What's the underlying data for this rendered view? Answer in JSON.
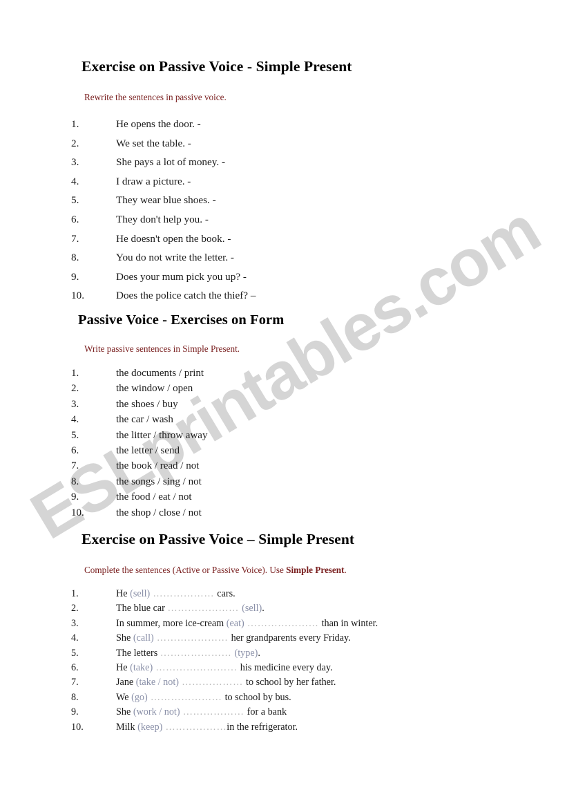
{
  "watermark": {
    "text": "ESLprintables.com",
    "color": "#d5d5d5"
  },
  "colors": {
    "instruction": "#7a2020",
    "verb_hint": "#8a90a8",
    "leader": "#b9b9b9",
    "body_text": "#1a1a1a"
  },
  "sections": [
    {
      "heading": "Exercise on Passive Voice - Simple Present",
      "instruction": "Rewrite the sentences in passive voice.",
      "items": [
        {
          "num": "1.",
          "text": "He opens the door. -"
        },
        {
          "num": "2.",
          "text": "We set the table. -"
        },
        {
          "num": "3.",
          "text": "She pays a lot of money. -"
        },
        {
          "num": "4.",
          "text": "I draw a picture. -"
        },
        {
          "num": "5.",
          "text": "They wear blue shoes. -"
        },
        {
          "num": "6.",
          "text": "They don't help you. -"
        },
        {
          "num": "7.",
          "text": "He doesn't open the book. -"
        },
        {
          "num": "8.",
          "text": "You do not write the letter. -"
        },
        {
          "num": "9.",
          "text": "Does your mum pick you up? -"
        },
        {
          "num": "10.",
          "text": "Does the police catch the thief? –"
        }
      ]
    },
    {
      "heading": "Passive Voice - Exercises on Form",
      "instruction": "Write passive sentences in Simple Present.",
      "items": [
        {
          "num": "1.",
          "text": "the documents / print"
        },
        {
          "num": "2.",
          "text": "the window / open"
        },
        {
          "num": "3.",
          "text": "the shoes / buy"
        },
        {
          "num": "4.",
          "text": "the car / wash"
        },
        {
          "num": "5.",
          "text": "the litter / throw away"
        },
        {
          "num": "6.",
          "text": "the letter / send"
        },
        {
          "num": "7.",
          "text": "the book / read / not"
        },
        {
          "num": "8.",
          "text": "the songs / sing / not"
        },
        {
          "num": "9.",
          "text": "the food / eat / not"
        },
        {
          "num": "10.",
          "text": "the shop / close / not"
        }
      ]
    },
    {
      "heading": "Exercise on Passive Voice – Simple Present",
      "instruction_prefix": "Complete the sentences (Active or Passive Voice). Use ",
      "instruction_bold": "Simple Present",
      "instruction_suffix": ".",
      "items": [
        {
          "num": "1.",
          "before": "He ",
          "verb": "(sell)",
          "leader": " ……………… ",
          "after": "cars."
        },
        {
          "num": "2.",
          "before": "The blue car ",
          "leader": "………………… ",
          "verb": "(sell)",
          "after": "."
        },
        {
          "num": "3.",
          "before": "In summer, more ice-cream ",
          "verb": "(eat)",
          "leader": " ………………… ",
          "after": "than in winter."
        },
        {
          "num": "4.",
          "before": "She ",
          "verb": "(call)",
          "leader": " ………………… ",
          "after": "her grandparents every Friday."
        },
        {
          "num": "5.",
          "before": "The letters ",
          "leader": "………………… ",
          "verb": "(type)",
          "after": "."
        },
        {
          "num": "6.",
          "before": "He ",
          "verb": "(take)",
          "leader": " …………………… ",
          "after": "his medicine every day."
        },
        {
          "num": "7.",
          "before": "Jane ",
          "verb": "(take / not)",
          "leader": " ……………… ",
          "after": "to school by her father."
        },
        {
          "num": "8.",
          "before": "We ",
          "verb": "(go)",
          "leader": " ………………… ",
          "after": "to school by bus."
        },
        {
          "num": "9.",
          "before": "She ",
          "verb": "(work / not)",
          "leader": " ……………… ",
          "after": "for a bank"
        },
        {
          "num": "10.",
          "before": "Milk ",
          "verb": "(keep)",
          "leader": " ………………",
          "after": "in the refrigerator."
        }
      ]
    }
  ]
}
